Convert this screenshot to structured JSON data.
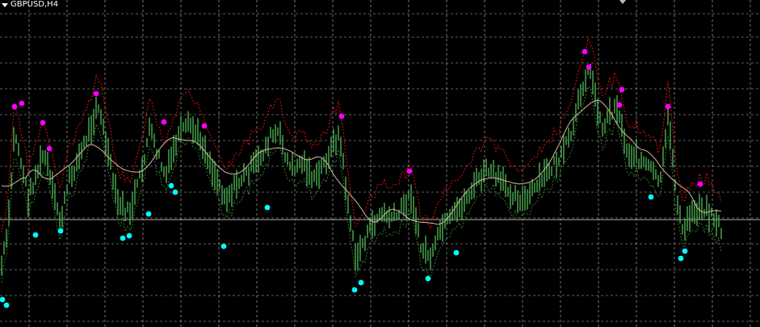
{
  "window": {
    "symbol_timeframe": "GBPUSD,H4"
  },
  "icons": {
    "menu": "triangle-down-icon",
    "shift_marker": "chart-shift-marker-icon"
  },
  "colors": {
    "background": "#000000",
    "grid": "#c0c0c0",
    "price_bars": "#4caf50",
    "upper_band": "#e01010",
    "lower_band": "#2e7d32",
    "middle_line": "#d8b8a0",
    "horizontal_line": "#b0b0b0",
    "peak_dots": "#ff00ff",
    "trough_dots": "#00ffff"
  },
  "chart_data": {
    "type": "line",
    "grid": true,
    "ylim": [
      0,
      100
    ],
    "xlim": [
      0,
      100
    ],
    "series": [
      {
        "values": [
          20,
          42,
          60,
          55,
          45,
          50,
          58,
          45,
          38,
          55,
          65,
          70,
          55,
          50,
          45,
          58,
          62,
          55,
          50,
          48,
          52,
          60,
          65,
          58,
          55,
          50,
          52,
          58,
          55,
          48,
          45,
          50,
          45,
          40,
          35,
          30,
          25,
          32,
          35,
          32,
          28,
          30,
          22,
          30,
          35,
          38,
          40,
          42,
          45,
          48,
          50,
          55,
          52,
          45,
          50,
          55,
          60,
          68,
          75,
          90,
          80,
          70,
          65,
          72,
          60,
          65,
          58,
          52,
          55,
          50,
          62,
          58,
          40,
          30,
          25,
          35,
          30,
          28
        ]
      },
      {
        "values": [
          55,
          62,
          58,
          60,
          58,
          62,
          60,
          68,
          72,
          65,
          60,
          62,
          68,
          70,
          65,
          60,
          58,
          62,
          65,
          68,
          70,
          62,
          60,
          58,
          55,
          52,
          50,
          48,
          45,
          42,
          40,
          38,
          35,
          38,
          42,
          45,
          48,
          52,
          55,
          58,
          60,
          62,
          68,
          70,
          72,
          70,
          74,
          78,
          82,
          86,
          88,
          90,
          87,
          82,
          78,
          75,
          70,
          68,
          64,
          65,
          62,
          58,
          60,
          55
        ]
      },
      {
        "values": [
          45,
          48,
          55,
          52,
          50,
          48,
          50,
          55,
          52,
          50,
          50,
          48,
          52,
          55,
          52,
          48,
          45,
          42,
          40,
          38,
          35,
          33,
          32,
          33,
          36,
          40,
          42,
          46,
          50,
          52,
          56,
          60,
          64,
          66,
          70,
          68,
          62,
          55,
          50,
          45,
          40,
          38
        ]
      },
      {
        "values": [
          38,
          40,
          45,
          44,
          40,
          38,
          40,
          42,
          44,
          40,
          40,
          38,
          42,
          44,
          40,
          38,
          35,
          30,
          28,
          25,
          22,
          20,
          18,
          22,
          24,
          26,
          30,
          34,
          38,
          40,
          44,
          46,
          50,
          52,
          56,
          54,
          48,
          42,
          38,
          32,
          28,
          25
        ]
      },
      {
        "values": [
          20,
          25,
          28,
          26,
          24,
          22,
          24,
          26,
          30,
          28,
          26,
          24,
          26,
          28,
          26,
          22,
          18,
          14,
          10,
          8,
          6,
          5,
          6,
          9,
          12,
          15,
          18,
          22,
          26,
          30,
          34,
          38,
          42,
          44,
          48,
          46,
          40,
          34,
          28,
          22,
          16,
          14
        ]
      }
    ],
    "peak_markers": 17,
    "trough_markers": 18
  }
}
